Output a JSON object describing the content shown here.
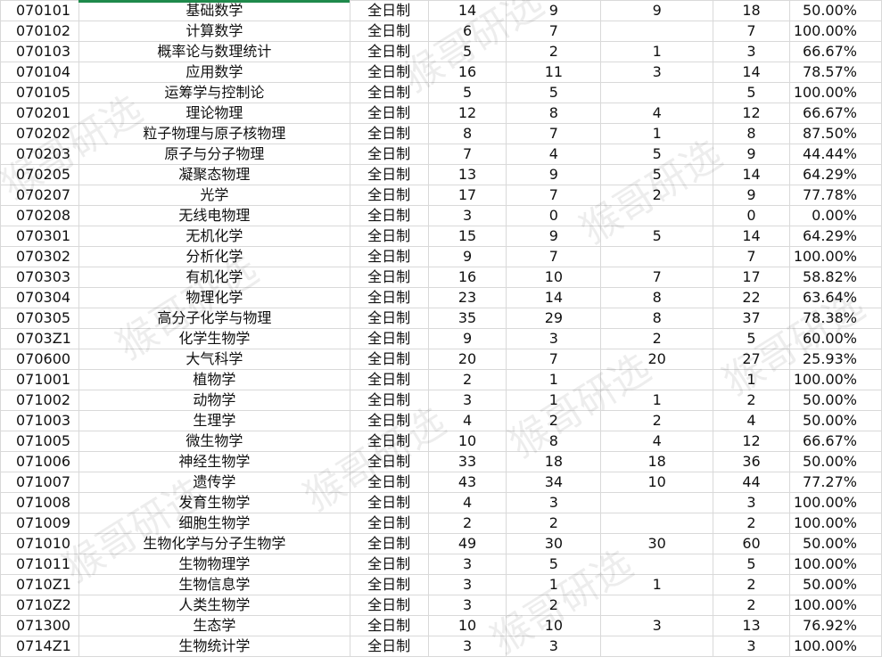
{
  "watermark": "猴哥研选",
  "rows": [
    [
      "070101",
      "基础数学",
      "全日制",
      "14",
      "9",
      "9",
      "18",
      "50.00%"
    ],
    [
      "070102",
      "计算数学",
      "全日制",
      "6",
      "7",
      "",
      "7",
      "100.00%"
    ],
    [
      "070103",
      "概率论与数理统计",
      "全日制",
      "5",
      "2",
      "1",
      "3",
      "66.67%"
    ],
    [
      "070104",
      "应用数学",
      "全日制",
      "16",
      "11",
      "3",
      "14",
      "78.57%"
    ],
    [
      "070105",
      "运筹学与控制论",
      "全日制",
      "5",
      "5",
      "",
      "5",
      "100.00%"
    ],
    [
      "070201",
      "理论物理",
      "全日制",
      "12",
      "8",
      "4",
      "12",
      "66.67%"
    ],
    [
      "070202",
      "粒子物理与原子核物理",
      "全日制",
      "8",
      "7",
      "1",
      "8",
      "87.50%"
    ],
    [
      "070203",
      "原子与分子物理",
      "全日制",
      "7",
      "4",
      "5",
      "9",
      "44.44%"
    ],
    [
      "070205",
      "凝聚态物理",
      "全日制",
      "13",
      "9",
      "5",
      "14",
      "64.29%"
    ],
    [
      "070207",
      "光学",
      "全日制",
      "17",
      "7",
      "2",
      "9",
      "77.78%"
    ],
    [
      "070208",
      "无线电物理",
      "全日制",
      "3",
      "0",
      "",
      "0",
      "0.00%"
    ],
    [
      "070301",
      "无机化学",
      "全日制",
      "15",
      "9",
      "5",
      "14",
      "64.29%"
    ],
    [
      "070302",
      "分析化学",
      "全日制",
      "9",
      "7",
      "",
      "7",
      "100.00%"
    ],
    [
      "070303",
      "有机化学",
      "全日制",
      "16",
      "10",
      "7",
      "17",
      "58.82%"
    ],
    [
      "070304",
      "物理化学",
      "全日制",
      "23",
      "14",
      "8",
      "22",
      "63.64%"
    ],
    [
      "070305",
      "高分子化学与物理",
      "全日制",
      "35",
      "29",
      "8",
      "37",
      "78.38%"
    ],
    [
      "0703Z1",
      "化学生物学",
      "全日制",
      "9",
      "3",
      "2",
      "5",
      "60.00%"
    ],
    [
      "070600",
      "大气科学",
      "全日制",
      "20",
      "7",
      "20",
      "27",
      "25.93%"
    ],
    [
      "071001",
      "植物学",
      "全日制",
      "2",
      "1",
      "",
      "1",
      "100.00%"
    ],
    [
      "071002",
      "动物学",
      "全日制",
      "3",
      "1",
      "1",
      "2",
      "50.00%"
    ],
    [
      "071003",
      "生理学",
      "全日制",
      "4",
      "2",
      "2",
      "4",
      "50.00%"
    ],
    [
      "071005",
      "微生物学",
      "全日制",
      "10",
      "8",
      "4",
      "12",
      "66.67%"
    ],
    [
      "071006",
      "神经生物学",
      "全日制",
      "33",
      "18",
      "18",
      "36",
      "50.00%"
    ],
    [
      "071007",
      "遗传学",
      "全日制",
      "43",
      "34",
      "10",
      "44",
      "77.27%"
    ],
    [
      "071008",
      "发育生物学",
      "全日制",
      "4",
      "3",
      "",
      "3",
      "100.00%"
    ],
    [
      "071009",
      "细胞生物学",
      "全日制",
      "2",
      "2",
      "",
      "2",
      "100.00%"
    ],
    [
      "071010",
      "生物化学与分子生物学",
      "全日制",
      "49",
      "30",
      "30",
      "60",
      "50.00%"
    ],
    [
      "071011",
      "生物物理学",
      "全日制",
      "3",
      "5",
      "",
      "5",
      "100.00%"
    ],
    [
      "0710Z1",
      "生物信息学",
      "全日制",
      "3",
      "1",
      "1",
      "2",
      "50.00%"
    ],
    [
      "0710Z2",
      "人类生物学",
      "全日制",
      "3",
      "2",
      "",
      "2",
      "100.00%"
    ],
    [
      "071300",
      "生态学",
      "全日制",
      "10",
      "10",
      "3",
      "13",
      "76.92%"
    ],
    [
      "0714Z1",
      "生物统计学",
      "全日制",
      "3",
      "3",
      "",
      "3",
      "100.00%"
    ]
  ]
}
